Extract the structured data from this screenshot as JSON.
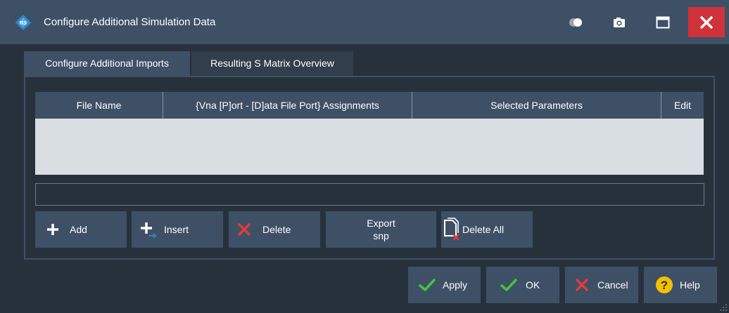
{
  "window": {
    "title": "Configure Additional Simulation Data",
    "icons": [
      "rs-logo-icon",
      "toggle-icon",
      "camera-icon",
      "maximize-icon",
      "close-icon"
    ],
    "close_color": "#d0323a"
  },
  "tabs": [
    {
      "label": "Configure Additional Imports",
      "active": true
    },
    {
      "label": "Resulting S Matrix Overview",
      "active": false
    }
  ],
  "table": {
    "columns": [
      "File Name",
      "{Vna [P]ort - [D]ata File Port} Assignments",
      "Selected Parameters",
      "Edit"
    ],
    "rows": []
  },
  "path_field": {
    "value": ""
  },
  "actions": {
    "add": "Add",
    "insert": "Insert",
    "delete": "Delete",
    "export_line1": "Export",
    "export_line2": "snp",
    "delete_all": "Delete All"
  },
  "footer": {
    "apply": "Apply",
    "ok": "OK",
    "cancel": "Cancel",
    "help": "Help"
  },
  "colors": {
    "background": "#27313b",
    "header": "#3e5066",
    "table_body": "#d9dee2",
    "check": "#46c43c",
    "cancel_x": "#e23b3b",
    "help": "#f5c000"
  }
}
